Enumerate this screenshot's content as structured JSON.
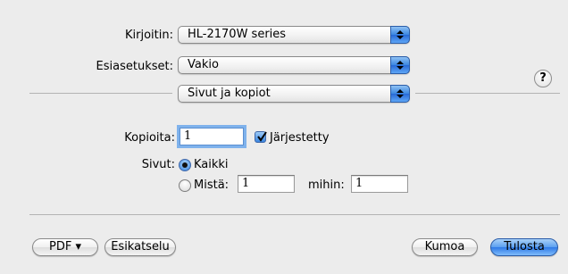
{
  "printer": {
    "label": "Kirjoitin:",
    "value": "HL-2170W series"
  },
  "presets": {
    "label": "Esiasetukset:",
    "value": "Vakio"
  },
  "section": {
    "value": "Sivut ja kopiot"
  },
  "help": {
    "symbol": "?"
  },
  "copies": {
    "label": "Kopioita:",
    "value": "1",
    "collated_label": "Järjestetty",
    "collated": true
  },
  "pages": {
    "label": "Sivut:",
    "all_label": "Kaikki",
    "from_label": "Mistä:",
    "from_value": "1",
    "to_label": "mihin:",
    "to_value": "1",
    "selected": "all"
  },
  "buttons": {
    "pdf": "PDF ▾",
    "preview": "Esikatselu",
    "cancel": "Kumoa",
    "print": "Tulosta"
  },
  "colors": {
    "accent": "#3b86e0",
    "background": "#ececec"
  }
}
